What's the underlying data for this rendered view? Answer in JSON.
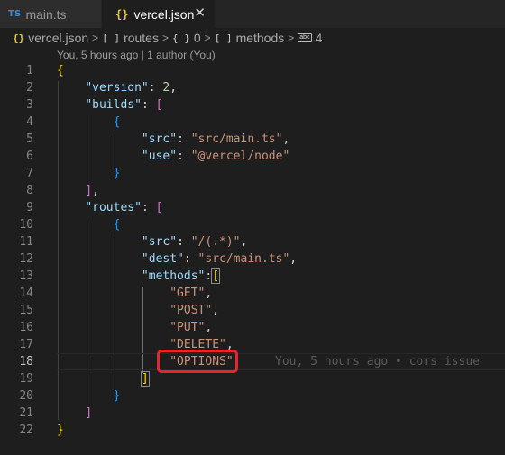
{
  "tabs": [
    {
      "icon": "TS",
      "label": "main.ts"
    },
    {
      "icon": "{}",
      "label": "vercel.json",
      "close": "✕"
    }
  ],
  "breadcrumb": {
    "file_icon": "{}",
    "file": "vercel.json",
    "sep": ">",
    "items": [
      {
        "icon": "[ ]",
        "label": "routes"
      },
      {
        "icon": "{ }",
        "label": "0"
      },
      {
        "icon": "[ ]",
        "label": "methods"
      },
      {
        "icon": "abc",
        "label": "4"
      }
    ]
  },
  "codelens": "You, 5 hours ago | 1 author (You)",
  "line_numbers": [
    "1",
    "2",
    "3",
    "4",
    "5",
    "6",
    "7",
    "8",
    "9",
    "10",
    "11",
    "12",
    "13",
    "14",
    "15",
    "16",
    "17",
    "18",
    "19",
    "20",
    "21",
    "22"
  ],
  "code": {
    "keys": [
      "\"version\"",
      "\"builds\"",
      "\"src\"",
      "\"use\"",
      "\"routes\"",
      "\"src\"",
      "\"dest\"",
      "\"methods\""
    ],
    "strings": [
      "\"src/main.ts\"",
      "\"@vercel/node\"",
      "\"/(.*)\"",
      "\"src/main.ts\"",
      "\"GET\"",
      "\"POST\"",
      "\"PUT\"",
      "\"DELETE\"",
      "\"OPTIONS\""
    ],
    "number": "2"
  },
  "current_line": 18,
  "blame": "You, 5 hours ago • cors issue",
  "colors": {
    "key": "#9cdcfe",
    "string": "#ce9178",
    "number": "#b5cea8",
    "highlight": "#e8232a"
  }
}
